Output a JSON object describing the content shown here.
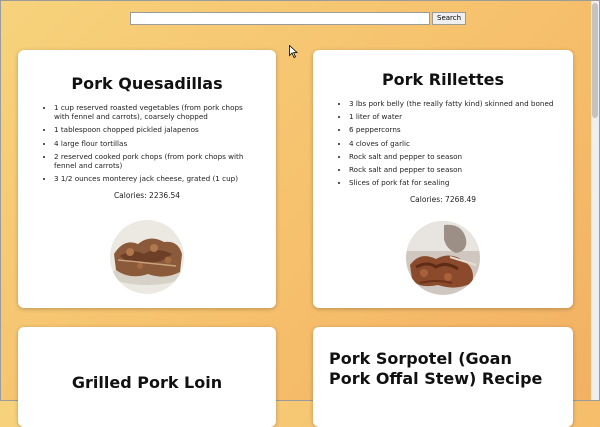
{
  "search": {
    "placeholder": "",
    "button_label": "Search"
  },
  "cards": [
    {
      "title": "Pork Quesadillas",
      "ingredients": [
        "1 cup reserved roasted vegetables (from pork chops with fennel and carrots), coarsely chopped",
        "1 tablespoon chopped pickled jalapenos",
        "4 large flour tortillas",
        "2 reserved cooked pork chops (from pork chops with fennel and carrots)",
        "3 1/2 ounces monterey jack cheese, grated (1 cup)"
      ],
      "calories": "Calories: 2236.54"
    },
    {
      "title": "Pork Rillettes",
      "ingredients": [
        "3 lbs pork belly (the really fatty kind) skinned and boned",
        "1 liter of water",
        "6 peppercorns",
        "4 cloves of garlic",
        "Rock salt and pepper to season",
        "Rock salt and pepper to season",
        "Slices of pork fat for sealing"
      ],
      "calories": "Calories: 7268.49"
    },
    {
      "title": "Grilled Pork Loin"
    },
    {
      "title": "Pork Sorpotel (Goan Pork Offal Stew) Recipe"
    }
  ]
}
